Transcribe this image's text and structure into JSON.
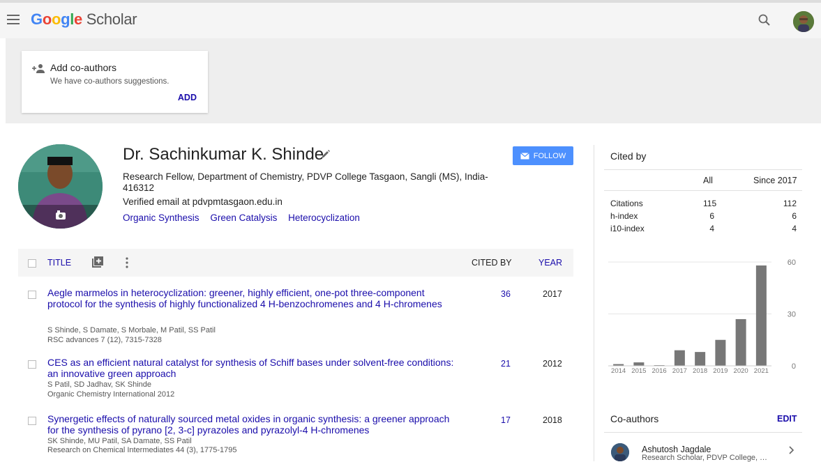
{
  "header": {
    "logo_google": "Google",
    "logo_scholar": "Scholar",
    "icons": [
      "menu-icon",
      "search-icon"
    ]
  },
  "coauthor_card": {
    "title": "Add co-authors",
    "subtitle": "We have co-authors suggestions.",
    "add_label": "ADD"
  },
  "profile": {
    "name": "Dr. Sachinkumar K. Shinde",
    "affiliation": "Research Fellow, Department of Chemistry, PDVP College Tasgaon, Sangli (MS), India-416312",
    "email": "Verified email at pdvpmtasgaon.edu.in",
    "interests": [
      "Organic Synthesis",
      "Green Catalysis",
      "Heterocyclization"
    ],
    "follow_label": "FOLLOW"
  },
  "articles": {
    "headers": {
      "title": "TITLE",
      "cited_by": "CITED BY",
      "year": "YEAR"
    },
    "rows": [
      {
        "title": "Aegle marmelos in heterocyclization: greener, highly efficient, one-pot three-component protocol for the synthesis of highly functionalized 4 H-benzochromenes and 4 H-chromenes",
        "authors": "S Shinde, S Damate, S Morbale, M Patil, SS Patil",
        "venue": "RSC advances 7 (12), 7315-7328",
        "cited_by": "36",
        "year": "2017"
      },
      {
        "title": "CES as an efficient natural catalyst for synthesis of Schiff bases under solvent-free conditions: an innovative green approach",
        "authors": "S Patil, SD Jadhav, SK Shinde",
        "venue": "Organic Chemistry International 2012",
        "cited_by": "21",
        "year": "2012"
      },
      {
        "title": "Synergetic effects of naturally sourced metal oxides in organic synthesis: a greener approach for the synthesis of pyrano [2, 3-c] pyrazoles and pyrazolyl-4 H-chromenes",
        "authors": "SK Shinde, MU Patil, SA Damate, SS Patil",
        "venue": "Research on Chemical Intermediates 44 (3), 1775-1795",
        "cited_by": "17",
        "year": "2018"
      }
    ]
  },
  "cited_by": {
    "title": "Cited by",
    "col_all": "All",
    "col_since": "Since 2017",
    "rows": [
      {
        "label": "Citations",
        "all": "115",
        "since": "112"
      },
      {
        "label": "h-index",
        "all": "6",
        "since": "6"
      },
      {
        "label": "i10-index",
        "all": "4",
        "since": "4"
      }
    ]
  },
  "chart_data": {
    "type": "bar",
    "categories": [
      "2014",
      "2015",
      "2016",
      "2017",
      "2018",
      "2019",
      "2020",
      "2021"
    ],
    "values": [
      1,
      2,
      0,
      9,
      8,
      15,
      27,
      58
    ],
    "ylim": [
      0,
      60
    ],
    "yticks": [
      "60",
      "30",
      "0"
    ],
    "bar_color": "#777777",
    "grid": true
  },
  "coauthors": {
    "title": "Co-authors",
    "edit_label": "EDIT",
    "items": [
      {
        "name": "Ashutosh Jagdale",
        "affiliation": "Research Scholar, PDVP College, Tasgaon"
      }
    ]
  },
  "colors": {
    "link": "#1a0dab",
    "follow": "#4d90fe"
  }
}
